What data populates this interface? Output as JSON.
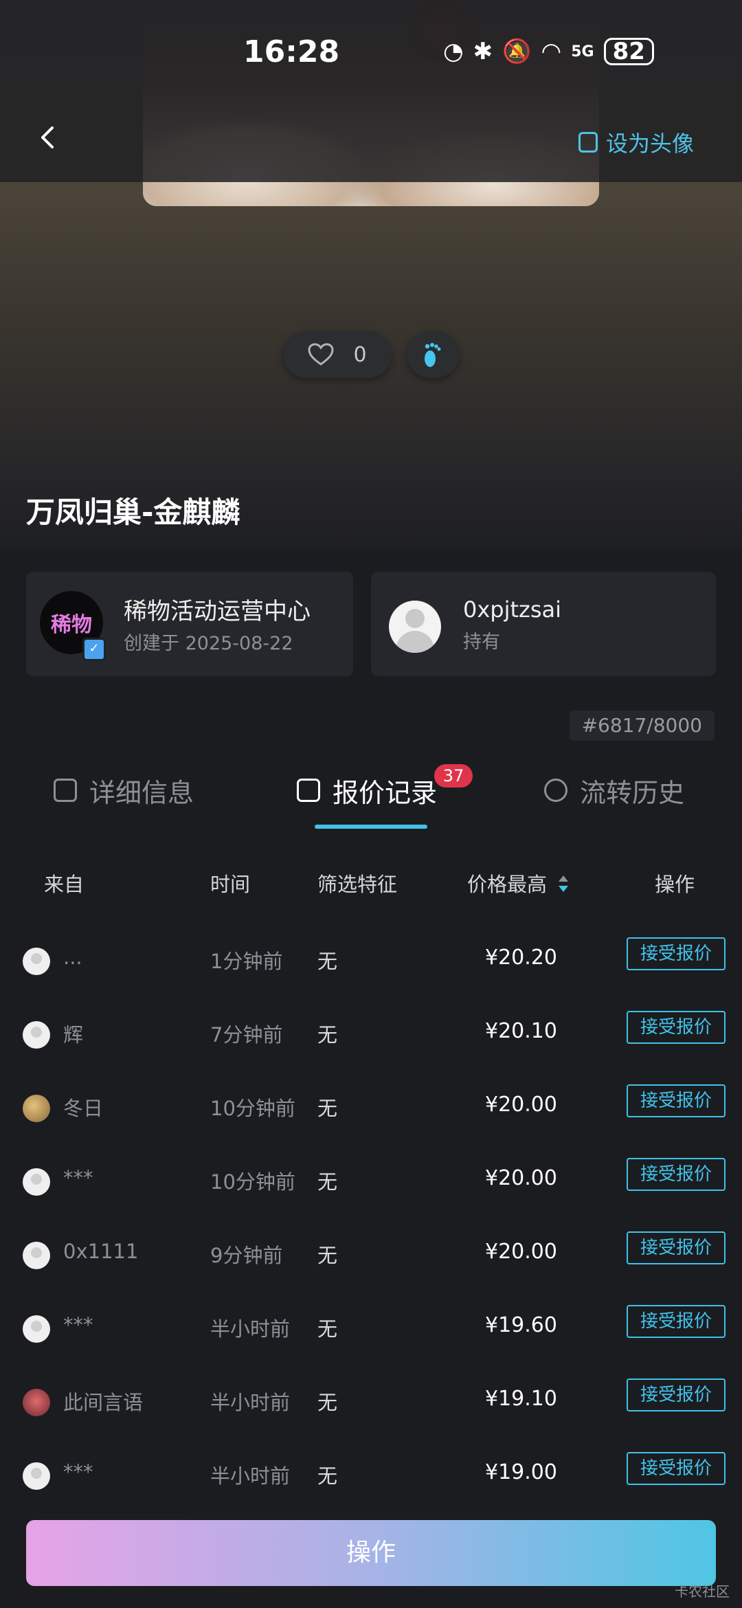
{
  "status_bar": {
    "time": "16:28",
    "battery": "82",
    "network": "5G"
  },
  "header": {
    "set_avatar_label": "设为头像"
  },
  "likes": {
    "count": "0"
  },
  "title": "万凤归巢-金麒麟",
  "creator": {
    "logo_text": "稀物",
    "name": "稀物活动运营中心",
    "created": "创建于 2025-08-22"
  },
  "owner": {
    "name": "0xpjtzsai",
    "status": "持有"
  },
  "serial": "#6817/8000",
  "tabs": [
    {
      "label": "详细信息"
    },
    {
      "label": "报价记录",
      "badge": "37"
    },
    {
      "label": "流转历史"
    }
  ],
  "table": {
    "headers": {
      "from": "来自",
      "time": "时间",
      "feature": "筛选特征",
      "price": "价格最高",
      "action": "操作"
    },
    "accept_label": "接受报价",
    "rows": [
      {
        "from": "...",
        "time": "1分钟前",
        "feature": "无",
        "price": "¥20.20"
      },
      {
        "from": "辉",
        "time": "7分钟前",
        "feature": "无",
        "price": "¥20.10"
      },
      {
        "from": "冬日",
        "time": "10分钟前",
        "feature": "无",
        "price": "¥20.00"
      },
      {
        "from": "***",
        "time": "10分钟前",
        "feature": "无",
        "price": "¥20.00"
      },
      {
        "from": "0x1111",
        "time": "9分钟前",
        "feature": "无",
        "price": "¥20.00"
      },
      {
        "from": "***",
        "time": "半小时前",
        "feature": "无",
        "price": "¥19.60"
      },
      {
        "from": "此间言语",
        "time": "半小时前",
        "feature": "无",
        "price": "¥19.10"
      },
      {
        "from": "***",
        "time": "半小时前",
        "feature": "无",
        "price": "¥19.00"
      }
    ]
  },
  "action_button": "操作",
  "watermark": "卡农社区",
  "colors": {
    "accent": "#3fc3ea",
    "badge": "#e0344a",
    "background": "#1b1c20"
  }
}
